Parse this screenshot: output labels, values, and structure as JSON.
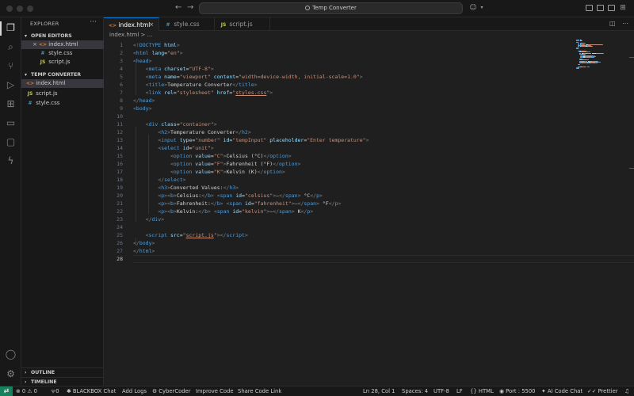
{
  "titlebar": {
    "search_text": "Temp Converter"
  },
  "sidebar": {
    "header": "EXPLORER",
    "more": "···",
    "open_editors": {
      "title": "OPEN EDITORS",
      "items": [
        {
          "icon": "<>",
          "name": "index.html"
        },
        {
          "icon": "#",
          "name": "style.css"
        },
        {
          "icon": "JS",
          "name": "script.js"
        }
      ]
    },
    "project": {
      "title": "TEMP CONVERTER",
      "items": [
        {
          "icon": "<>",
          "name": "index.html"
        },
        {
          "icon": "JS",
          "name": "script.js"
        },
        {
          "icon": "#",
          "name": "style.css"
        }
      ]
    },
    "outline": "OUTLINE",
    "timeline": "TIMELINE"
  },
  "tabs": [
    {
      "icon": "<>",
      "label": "index.html",
      "close": "×"
    },
    {
      "icon": "#",
      "label": "style.css"
    },
    {
      "icon": "JS",
      "label": "script.js"
    }
  ],
  "breadcrumb": "index.html > ...",
  "editor": {
    "current_line": 28,
    "lines": [
      [
        [
          "br",
          "<!"
        ],
        [
          "tag",
          "DOCTYPE"
        ],
        [
          "txt",
          " "
        ],
        [
          "attr",
          "html"
        ],
        [
          "br",
          ">"
        ]
      ],
      [
        [
          "br",
          "<"
        ],
        [
          "tag",
          "html"
        ],
        [
          "txt",
          " "
        ],
        [
          "attr",
          "lang"
        ],
        [
          "txt",
          "="
        ],
        [
          "str",
          "\"en\""
        ],
        [
          "br",
          ">"
        ]
      ],
      [
        [
          "br",
          "<"
        ],
        [
          "tag",
          "head"
        ],
        [
          "br",
          ">"
        ]
      ],
      [
        [
          "txt",
          "    "
        ],
        [
          "br",
          "<"
        ],
        [
          "tag",
          "meta"
        ],
        [
          "txt",
          " "
        ],
        [
          "attr",
          "charset"
        ],
        [
          "txt",
          "="
        ],
        [
          "str",
          "\"UTF-8\""
        ],
        [
          "br",
          ">"
        ]
      ],
      [
        [
          "txt",
          "    "
        ],
        [
          "br",
          "<"
        ],
        [
          "tag",
          "meta"
        ],
        [
          "txt",
          " "
        ],
        [
          "attr",
          "name"
        ],
        [
          "txt",
          "="
        ],
        [
          "str",
          "\"viewport\""
        ],
        [
          "txt",
          " "
        ],
        [
          "attr",
          "content"
        ],
        [
          "txt",
          "="
        ],
        [
          "str",
          "\"width=device-width, initial-scale=1.0\""
        ],
        [
          "br",
          ">"
        ]
      ],
      [
        [
          "txt",
          "    "
        ],
        [
          "br",
          "<"
        ],
        [
          "tag",
          "title"
        ],
        [
          "br",
          ">"
        ],
        [
          "txt",
          "Temperature Converter"
        ],
        [
          "br",
          "</"
        ],
        [
          "tag",
          "title"
        ],
        [
          "br",
          ">"
        ]
      ],
      [
        [
          "txt",
          "    "
        ],
        [
          "br",
          "<"
        ],
        [
          "tag",
          "link"
        ],
        [
          "txt",
          " "
        ],
        [
          "attr",
          "rel"
        ],
        [
          "txt",
          "="
        ],
        [
          "str",
          "\"stylesheet\""
        ],
        [
          "txt",
          " "
        ],
        [
          "attr",
          "href"
        ],
        [
          "txt",
          "="
        ],
        [
          "str",
          "\""
        ],
        [
          "stru",
          "styles.css"
        ],
        [
          "str",
          "\""
        ],
        [
          "br",
          ">"
        ]
      ],
      [
        [
          "br",
          "</"
        ],
        [
          "tag",
          "head"
        ],
        [
          "br",
          ">"
        ]
      ],
      [
        [
          "br",
          "<"
        ],
        [
          "tag",
          "body"
        ],
        [
          "br",
          ">"
        ]
      ],
      [],
      [
        [
          "txt",
          "    "
        ],
        [
          "br",
          "<"
        ],
        [
          "tag",
          "div"
        ],
        [
          "txt",
          " "
        ],
        [
          "attr",
          "class"
        ],
        [
          "txt",
          "="
        ],
        [
          "str",
          "\"container\""
        ],
        [
          "br",
          ">"
        ]
      ],
      [
        [
          "txt",
          "        "
        ],
        [
          "br",
          "<"
        ],
        [
          "tag",
          "h2"
        ],
        [
          "br",
          ">"
        ],
        [
          "txt",
          "Temperature Converter"
        ],
        [
          "br",
          "</"
        ],
        [
          "tag",
          "h2"
        ],
        [
          "br",
          ">"
        ]
      ],
      [
        [
          "txt",
          "        "
        ],
        [
          "br",
          "<"
        ],
        [
          "tag",
          "input"
        ],
        [
          "txt",
          " "
        ],
        [
          "attr",
          "type"
        ],
        [
          "txt",
          "="
        ],
        [
          "str",
          "\"number\""
        ],
        [
          "txt",
          " "
        ],
        [
          "attr",
          "id"
        ],
        [
          "txt",
          "="
        ],
        [
          "str",
          "\"tempInput\""
        ],
        [
          "txt",
          " "
        ],
        [
          "attr",
          "placeholder"
        ],
        [
          "txt",
          "="
        ],
        [
          "str",
          "\"Enter temperature\""
        ],
        [
          "br",
          ">"
        ]
      ],
      [
        [
          "txt",
          "        "
        ],
        [
          "br",
          "<"
        ],
        [
          "tag",
          "select"
        ],
        [
          "txt",
          " "
        ],
        [
          "attr",
          "id"
        ],
        [
          "txt",
          "="
        ],
        [
          "str",
          "\"unit\""
        ],
        [
          "br",
          ">"
        ]
      ],
      [
        [
          "txt",
          "            "
        ],
        [
          "br",
          "<"
        ],
        [
          "tag",
          "option"
        ],
        [
          "txt",
          " "
        ],
        [
          "attr",
          "value"
        ],
        [
          "txt",
          "="
        ],
        [
          "str",
          "\"C\""
        ],
        [
          "br",
          ">"
        ],
        [
          "txt",
          "Celsius (°C)"
        ],
        [
          "br",
          "</"
        ],
        [
          "tag",
          "option"
        ],
        [
          "br",
          ">"
        ]
      ],
      [
        [
          "txt",
          "            "
        ],
        [
          "br",
          "<"
        ],
        [
          "tag",
          "option"
        ],
        [
          "txt",
          " "
        ],
        [
          "attr",
          "value"
        ],
        [
          "txt",
          "="
        ],
        [
          "str",
          "\"F\""
        ],
        [
          "br",
          ">"
        ],
        [
          "txt",
          "Fahrenheit (°F)"
        ],
        [
          "br",
          "</"
        ],
        [
          "tag",
          "option"
        ],
        [
          "br",
          ">"
        ]
      ],
      [
        [
          "txt",
          "            "
        ],
        [
          "br",
          "<"
        ],
        [
          "tag",
          "option"
        ],
        [
          "txt",
          " "
        ],
        [
          "attr",
          "value"
        ],
        [
          "txt",
          "="
        ],
        [
          "str",
          "\"K\""
        ],
        [
          "br",
          ">"
        ],
        [
          "txt",
          "Kelvin (K)"
        ],
        [
          "br",
          "</"
        ],
        [
          "tag",
          "option"
        ],
        [
          "br",
          ">"
        ]
      ],
      [
        [
          "txt",
          "        "
        ],
        [
          "br",
          "</"
        ],
        [
          "tag",
          "select"
        ],
        [
          "br",
          ">"
        ]
      ],
      [
        [
          "txt",
          "        "
        ],
        [
          "br",
          "<"
        ],
        [
          "tag",
          "h3"
        ],
        [
          "br",
          ">"
        ],
        [
          "txt",
          "Converted Values:"
        ],
        [
          "br",
          "</"
        ],
        [
          "tag",
          "h3"
        ],
        [
          "br",
          ">"
        ]
      ],
      [
        [
          "txt",
          "        "
        ],
        [
          "br",
          "<"
        ],
        [
          "tag",
          "p"
        ],
        [
          "br",
          ">"
        ],
        [
          "br",
          "<"
        ],
        [
          "tag",
          "b"
        ],
        [
          "br",
          ">"
        ],
        [
          "txt",
          "Celsius:"
        ],
        [
          "br",
          "</"
        ],
        [
          "tag",
          "b"
        ],
        [
          "br",
          ">"
        ],
        [
          "txt",
          " "
        ],
        [
          "br",
          "<"
        ],
        [
          "tag",
          "span"
        ],
        [
          "txt",
          " "
        ],
        [
          "attr",
          "id"
        ],
        [
          "txt",
          "="
        ],
        [
          "str",
          "\"celsius\""
        ],
        [
          "br",
          ">"
        ],
        [
          "txt",
          "—"
        ],
        [
          "br",
          "</"
        ],
        [
          "tag",
          "span"
        ],
        [
          "br",
          ">"
        ],
        [
          "txt",
          " °C"
        ],
        [
          "br",
          "</"
        ],
        [
          "tag",
          "p"
        ],
        [
          "br",
          ">"
        ]
      ],
      [
        [
          "txt",
          "        "
        ],
        [
          "br",
          "<"
        ],
        [
          "tag",
          "p"
        ],
        [
          "br",
          ">"
        ],
        [
          "br",
          "<"
        ],
        [
          "tag",
          "b"
        ],
        [
          "br",
          ">"
        ],
        [
          "txt",
          "Fahrenheit:"
        ],
        [
          "br",
          "</"
        ],
        [
          "tag",
          "b"
        ],
        [
          "br",
          ">"
        ],
        [
          "txt",
          " "
        ],
        [
          "br",
          "<"
        ],
        [
          "tag",
          "span"
        ],
        [
          "txt",
          " "
        ],
        [
          "attr",
          "id"
        ],
        [
          "txt",
          "="
        ],
        [
          "str",
          "\"fahrenheit\""
        ],
        [
          "br",
          ">"
        ],
        [
          "txt",
          "—"
        ],
        [
          "br",
          "</"
        ],
        [
          "tag",
          "span"
        ],
        [
          "br",
          ">"
        ],
        [
          "txt",
          " °F"
        ],
        [
          "br",
          "</"
        ],
        [
          "tag",
          "p"
        ],
        [
          "br",
          ">"
        ]
      ],
      [
        [
          "txt",
          "        "
        ],
        [
          "br",
          "<"
        ],
        [
          "tag",
          "p"
        ],
        [
          "br",
          ">"
        ],
        [
          "br",
          "<"
        ],
        [
          "tag",
          "b"
        ],
        [
          "br",
          ">"
        ],
        [
          "txt",
          "Kelvin:"
        ],
        [
          "br",
          "</"
        ],
        [
          "tag",
          "b"
        ],
        [
          "br",
          ">"
        ],
        [
          "txt",
          " "
        ],
        [
          "br",
          "<"
        ],
        [
          "tag",
          "span"
        ],
        [
          "txt",
          " "
        ],
        [
          "attr",
          "id"
        ],
        [
          "txt",
          "="
        ],
        [
          "str",
          "\"kelvin\""
        ],
        [
          "br",
          ">"
        ],
        [
          "txt",
          "—"
        ],
        [
          "br",
          "</"
        ],
        [
          "tag",
          "span"
        ],
        [
          "br",
          ">"
        ],
        [
          "txt",
          " K"
        ],
        [
          "br",
          "</"
        ],
        [
          "tag",
          "p"
        ],
        [
          "br",
          ">"
        ]
      ],
      [
        [
          "txt",
          "    "
        ],
        [
          "br",
          "</"
        ],
        [
          "tag",
          "div"
        ],
        [
          "br",
          ">"
        ]
      ],
      [],
      [
        [
          "txt",
          "    "
        ],
        [
          "br",
          "<"
        ],
        [
          "tag",
          "script"
        ],
        [
          "txt",
          " "
        ],
        [
          "attr",
          "src"
        ],
        [
          "txt",
          "="
        ],
        [
          "str",
          "\""
        ],
        [
          "stru",
          "script.js"
        ],
        [
          "str",
          "\""
        ],
        [
          "br",
          "></"
        ],
        [
          "tag",
          "script"
        ],
        [
          "br",
          ">"
        ]
      ],
      [
        [
          "br",
          "</"
        ],
        [
          "tag",
          "body"
        ],
        [
          "br",
          ">"
        ]
      ],
      [
        [
          "br",
          "</"
        ],
        [
          "tag",
          "html"
        ],
        [
          "br",
          ">"
        ]
      ],
      []
    ]
  },
  "statusbar": {
    "errors": "0",
    "warnings": "0",
    "ports": "0",
    "left_items": [
      "BLACKBOX Chat",
      "Add Logs",
      "CyberCoder",
      "Improve Code",
      "Share Code Link"
    ],
    "position": "Ln 28, Col 1",
    "spaces": "Spaces: 4",
    "encoding": "UTF-8",
    "eol": "LF",
    "language": "HTML",
    "port": "Port : 5500",
    "ai_chat": "AI Code Chat",
    "prettier": "Prettier"
  }
}
